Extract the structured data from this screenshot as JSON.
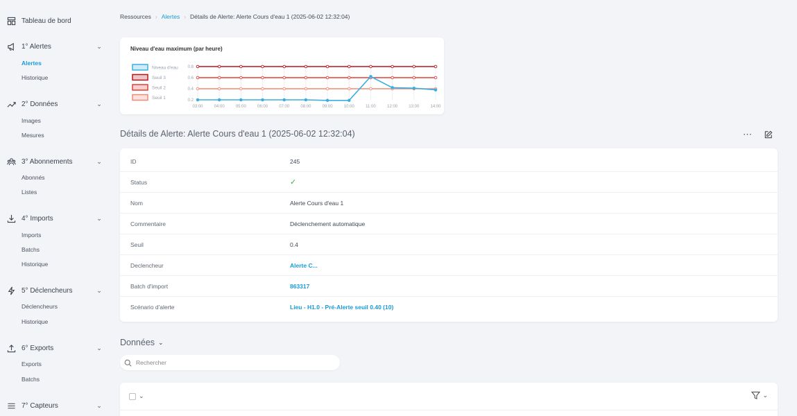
{
  "sidebar": {
    "dashboard": {
      "label": "Tableau de bord",
      "icon": "dashboard-icon"
    },
    "sections": [
      {
        "label": "1° Alertes",
        "icon": "megaphone-icon",
        "items": [
          "Alertes",
          "Historique"
        ],
        "active_item": "Alertes"
      },
      {
        "label": "2° Données",
        "icon": "trend-icon",
        "items": [
          "Images",
          "Mesures"
        ]
      },
      {
        "label": "3° Abonnements",
        "icon": "users-icon",
        "items": [
          "Abonnés",
          "Listes"
        ]
      },
      {
        "label": "4° Imports",
        "icon": "download-icon",
        "items": [
          "Imports",
          "Batchs",
          "Historique"
        ]
      },
      {
        "label": "5° Déclencheurs",
        "icon": "lightning-icon",
        "items": [
          "Déclencheurs",
          "Historique"
        ]
      },
      {
        "label": "6° Exports",
        "icon": "upload-icon",
        "items": [
          "Exports",
          "Batchs"
        ]
      },
      {
        "label": "7° Capteurs",
        "icon": "list-icon",
        "items": []
      }
    ]
  },
  "breadcrumb": {
    "items": [
      "Ressources",
      "Alertes",
      "Détails de Alerte: Alerte Cours d'eau 1 (2025-06-02 12:32:04)"
    ]
  },
  "chart_data": {
    "type": "line",
    "title": "Niveau d'eau maximum (par heure)",
    "x": [
      "03:00",
      "04:00",
      "05:00",
      "06:00",
      "07:00",
      "08:00",
      "09:00",
      "10:00",
      "11:00",
      "12:00",
      "13:00",
      "14:00"
    ],
    "ylim": [
      0.2,
      0.8
    ],
    "yticks": [
      "0.2",
      "0.4",
      "0.6",
      "0.8"
    ],
    "legend_position": "left",
    "grid": true,
    "series": [
      {
        "name": "Niveau d'eau",
        "color": "#3aaee0",
        "values": [
          0.2,
          0.2,
          0.2,
          0.2,
          0.2,
          0.2,
          0.19,
          0.19,
          0.62,
          0.42,
          0.41,
          0.38
        ]
      },
      {
        "name": "Seuil 3",
        "color": "#b3171d",
        "values": [
          0.8,
          0.8,
          0.8,
          0.8,
          0.8,
          0.8,
          0.8,
          0.8,
          0.8,
          0.8,
          0.8,
          0.8
        ]
      },
      {
        "name": "Seuil 2",
        "color": "#e0403a",
        "values": [
          0.6,
          0.6,
          0.6,
          0.6,
          0.6,
          0.6,
          0.6,
          0.6,
          0.6,
          0.6,
          0.6,
          0.6
        ]
      },
      {
        "name": "Seuil 1",
        "color": "#f08a74",
        "values": [
          0.4,
          0.4,
          0.4,
          0.4,
          0.4,
          0.4,
          0.4,
          0.4,
          0.4,
          0.4,
          0.4,
          0.4
        ]
      }
    ]
  },
  "details": {
    "title": "Détails de Alerte: Alerte Cours d'eau 1 (2025-06-02 12:32:04)",
    "more_icon": "more-horizontal-icon",
    "edit_icon": "edit-icon",
    "rows": [
      {
        "key": "ID",
        "value": "245"
      },
      {
        "key": "Status",
        "value": "✓"
      },
      {
        "key": "Nom",
        "value": "Alerte Cours d'eau 1"
      },
      {
        "key": "Commentaire",
        "value": "Déclenchement automatique"
      },
      {
        "key": "Seuil",
        "value": "0.4"
      },
      {
        "key": "Declencheur",
        "value": "Alerte C..."
      },
      {
        "key": "Batch d'import",
        "value": "863317"
      },
      {
        "key": "Scénario d'alerte",
        "value": "Lieu - H1.0 - Pré-Alerte seuil 0.40 (10)"
      }
    ]
  },
  "donnees": {
    "title": "Données",
    "search_placeholder": "Rechercher"
  }
}
